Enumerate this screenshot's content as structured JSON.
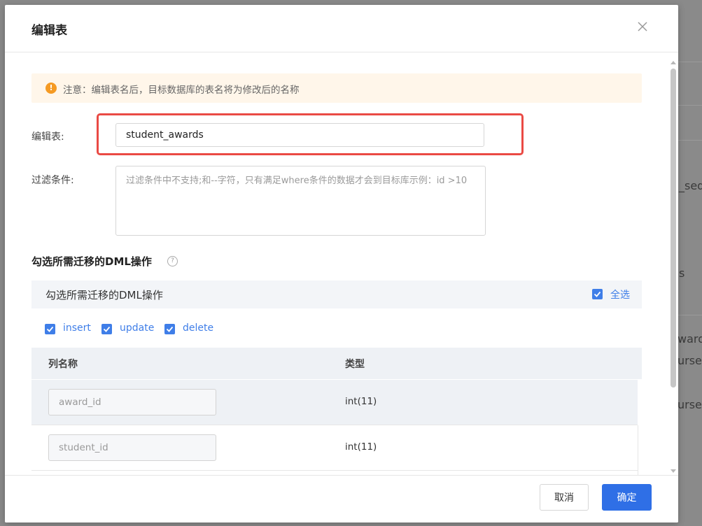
{
  "background": {
    "texts": [
      {
        "id": "bg-1",
        "text": "_seq"
      },
      {
        "id": "bg-2",
        "text": "s"
      },
      {
        "id": "bg-3",
        "text": "wards"
      },
      {
        "id": "bg-4",
        "text": "urses"
      },
      {
        "id": "bg-5",
        "text": "urses"
      }
    ]
  },
  "modal": {
    "title": "编辑表",
    "notice": "注意：编辑表名后，目标数据库的表名将为修改后的名称",
    "table_name_label": "编辑表:",
    "table_name_value": "student_awards",
    "filter_label": "过滤条件:",
    "filter_placeholder": "过滤条件中不支持;和--字符，只有满足where条件的数据才会到目标库示例：id >10",
    "dml_section_title": "勾选所需迁移的DML操作",
    "dml_box_title": "勾选所需迁移的DML操作",
    "select_all": "全选",
    "dml_options": [
      "insert",
      "update",
      "delete"
    ],
    "columns_header": {
      "name": "列名称",
      "type": "类型"
    },
    "rows": [
      {
        "name": "award_id",
        "type": "int(11)"
      },
      {
        "name": "student_id",
        "type": "int(11)"
      }
    ],
    "footer": {
      "cancel": "取消",
      "ok": "确定"
    }
  },
  "colors": {
    "primary": "#2f6fe6",
    "warning": "#f59a23",
    "highlight": "#ea4a44"
  }
}
